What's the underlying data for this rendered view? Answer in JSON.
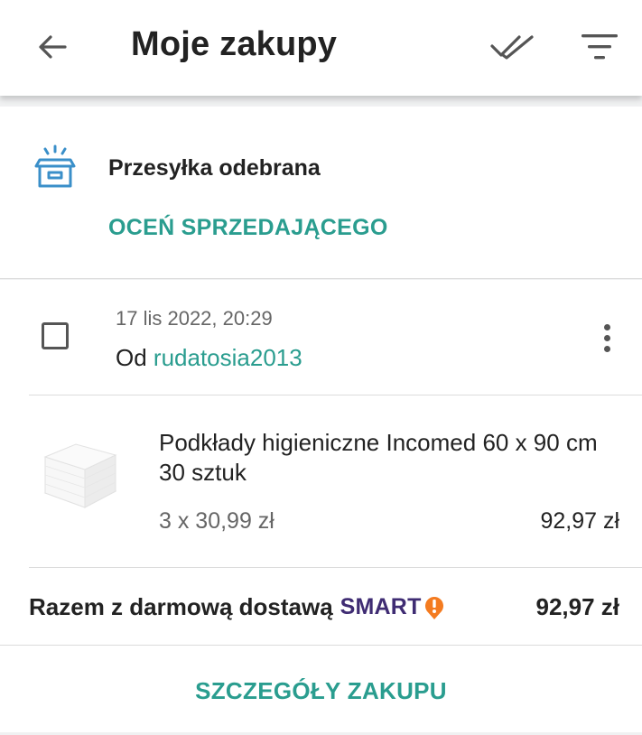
{
  "appbar": {
    "back_icon": "arrow-left-icon",
    "title": "Moje zakupy",
    "mark_all_icon": "double-check-icon",
    "filter_icon": "filter-icon"
  },
  "status": {
    "icon": "open-box-icon",
    "text": "Przesyłka odebrana",
    "rate_seller": "OCEŃ SPRZEDAJĄCEGO"
  },
  "order": {
    "date": "17 lis 2022, 20:29",
    "seller_prefix": "Od",
    "seller_name": "rudatosia2013",
    "more_icon": "more-vertical-icon",
    "item": {
      "name": "Podkłady higieniczne Incomed 60 x 90 cm 30 sztuk",
      "unit_price": "3 x 30,99 zł",
      "line_total": "92,97 zł"
    },
    "total_label": "Razem z darmową dostawą",
    "smart_label": "SMART",
    "total_value": "92,97 zł",
    "details_link": "SZCZEGÓŁY ZAKUPU"
  },
  "colors": {
    "accent": "#2a9d8f",
    "smart": "#3f2c73",
    "smart_badge": "#f47b20",
    "status_icon": "#3a8fc9"
  }
}
